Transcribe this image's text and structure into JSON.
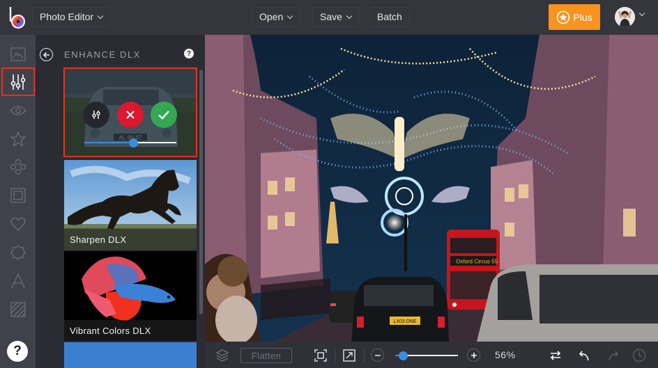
{
  "topbar": {
    "app_menu_label": "Photo Editor",
    "open_label": "Open",
    "save_label": "Save",
    "batch_label": "Batch",
    "plus_label": "Plus",
    "colors": {
      "plus": "#f7931e",
      "bar": "#34353d"
    }
  },
  "sidebar": {
    "items": [
      {
        "name": "image",
        "icon": "image-icon"
      },
      {
        "name": "edit",
        "icon": "sliders-icon",
        "active": true
      },
      {
        "name": "touch-up",
        "icon": "eye-icon"
      },
      {
        "name": "effects",
        "icon": "star-icon"
      },
      {
        "name": "overlays",
        "icon": "circles-icon"
      },
      {
        "name": "frames",
        "icon": "frame-icon"
      },
      {
        "name": "graphics",
        "icon": "heart-icon"
      },
      {
        "name": "overlay-shapes",
        "icon": "badge-icon"
      },
      {
        "name": "text",
        "icon": "text-icon"
      },
      {
        "name": "textures",
        "icon": "texture-icon"
      }
    ],
    "help_label": "?"
  },
  "panel": {
    "title": "ENHANCE DLX",
    "help_label": "?",
    "selected_card": {
      "plate_text": "AL-90-97",
      "intensity_fraction": 0.53
    },
    "cards": [
      {
        "label": "Sharpen DLX"
      },
      {
        "label": "Vibrant Colors DLX"
      },
      {
        "label": ""
      }
    ]
  },
  "bottombar": {
    "flatten_label": "Flatten",
    "zoom_percent": "56%",
    "zoom_fraction": 0.12
  },
  "canvas": {
    "bus_sign": "Oxford Circus 55",
    "taxi_plate": "LX03 DNE"
  }
}
